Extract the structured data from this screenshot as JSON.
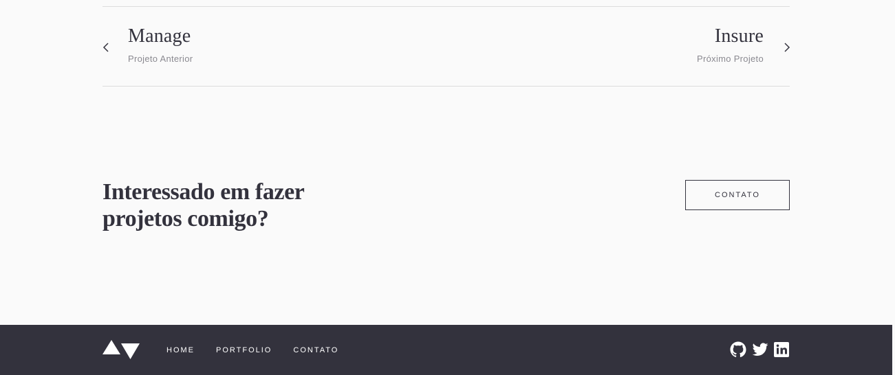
{
  "project_nav": {
    "previous": {
      "title": "Manage",
      "label": "Projeto Anterior",
      "icon": "chevron-left-icon"
    },
    "next": {
      "title": "Insure",
      "label": "Próximo Projeto",
      "icon": "chevron-right-icon"
    }
  },
  "cta": {
    "heading_line1": "Interessado em fazer",
    "heading_line2": "projetos comigo?",
    "button_label": "CONTATO"
  },
  "footer": {
    "logo_icon": "av-logo-icon",
    "links": [
      "HOME",
      "PORTFOLIO",
      "CONTATO"
    ],
    "social": [
      {
        "icon": "github-icon"
      },
      {
        "icon": "twitter-icon"
      },
      {
        "icon": "linkedin-icon"
      }
    ]
  },
  "colors": {
    "background": "#fafafa",
    "text_dark": "#33323d",
    "text_muted": "#8a8990",
    "divider": "#dcdcdc",
    "footer_bg": "#33323d",
    "footer_text": "#ffffff"
  }
}
